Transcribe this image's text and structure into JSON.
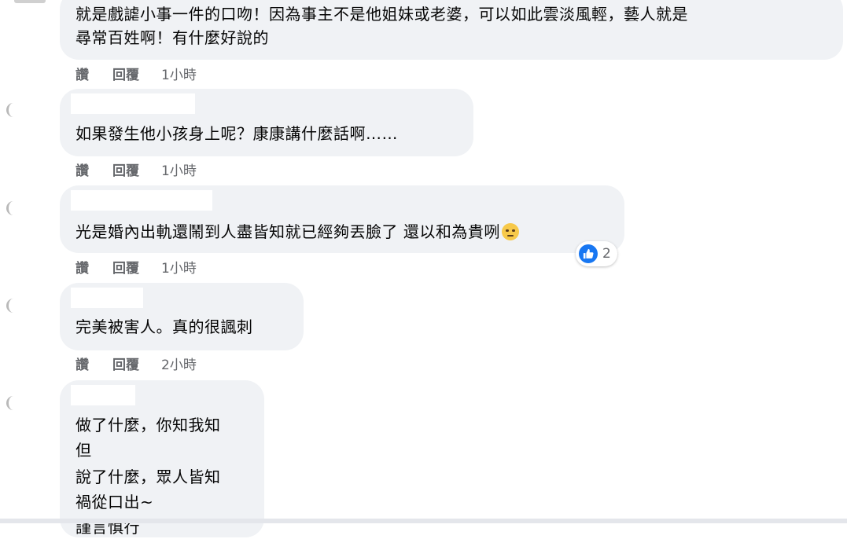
{
  "actions": {
    "like": "讚",
    "reply": "回覆"
  },
  "comments": [
    {
      "lines": [
        "就是戲謔小事一件的口吻！因為事主不是他姐妹或老婆，可以如此雲淡風輕，藝人就是",
        "尋常百姓啊！有什麼好說的"
      ],
      "time": "1小時"
    },
    {
      "lines": [
        "如果發生他小孩身上呢？康康講什麼話啊……"
      ],
      "time": "1小時"
    },
    {
      "lines": [
        "光是婚內出軌還鬧到人盡皆知就已經夠丟臉了 還以和為貴咧"
      ],
      "emoji": "rolling-eyes-face",
      "reaction": {
        "icon": "like-icon",
        "count": "2"
      },
      "time": "1小時"
    },
    {
      "lines": [
        "完美被害人。真的很諷刺"
      ],
      "time": "2小時"
    },
    {
      "lines": [
        "做了什麼，你知我知",
        "但",
        "說了什麼，眾人皆知",
        "禍從口出~",
        "謹言慎行"
      ]
    }
  ],
  "colors": {
    "bubble": "#f0f2f5",
    "meta": "#65676b",
    "like_blue": "#1877f2"
  }
}
